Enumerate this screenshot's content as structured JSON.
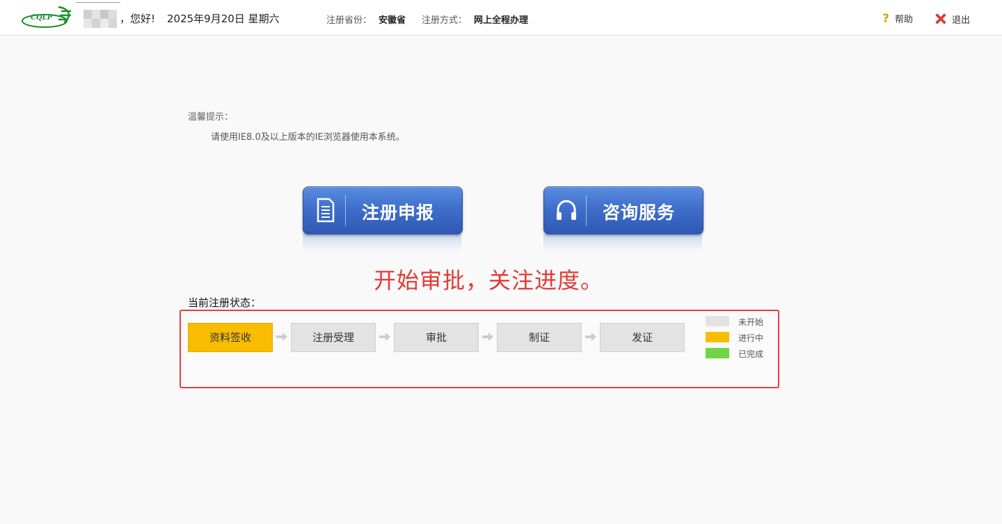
{
  "header": {
    "greeting": "，您好!",
    "date": "2025年9月20日 星期六",
    "province_label": "注册省份：",
    "province_value": "安徽省",
    "method_label": "注册方式：",
    "method_value": "网上全程办理",
    "help_label": "帮助",
    "exit_label": "退出",
    "logo_text": "CQLP"
  },
  "tips": {
    "title": "温馨提示：",
    "text": "请使用IE8.0及以上版本的IE浏览器使用本系统。"
  },
  "buttons": {
    "register": "注册申报",
    "consult": "咨询服务"
  },
  "announcement": "开始审批，关注进度。",
  "status": {
    "title": "当前注册状态：",
    "steps": [
      "资料签收",
      "注册受理",
      "审批",
      "制证",
      "发证"
    ],
    "active_step": 0,
    "legend": [
      {
        "label": "未开始",
        "color": "#e3e3e3"
      },
      {
        "label": "进行中",
        "color": "#f9bd00"
      },
      {
        "label": "已完成",
        "color": "#6fd544"
      }
    ]
  },
  "colors": {
    "accent_blue": "#3f6fcb",
    "alert_red": "#e53935"
  }
}
